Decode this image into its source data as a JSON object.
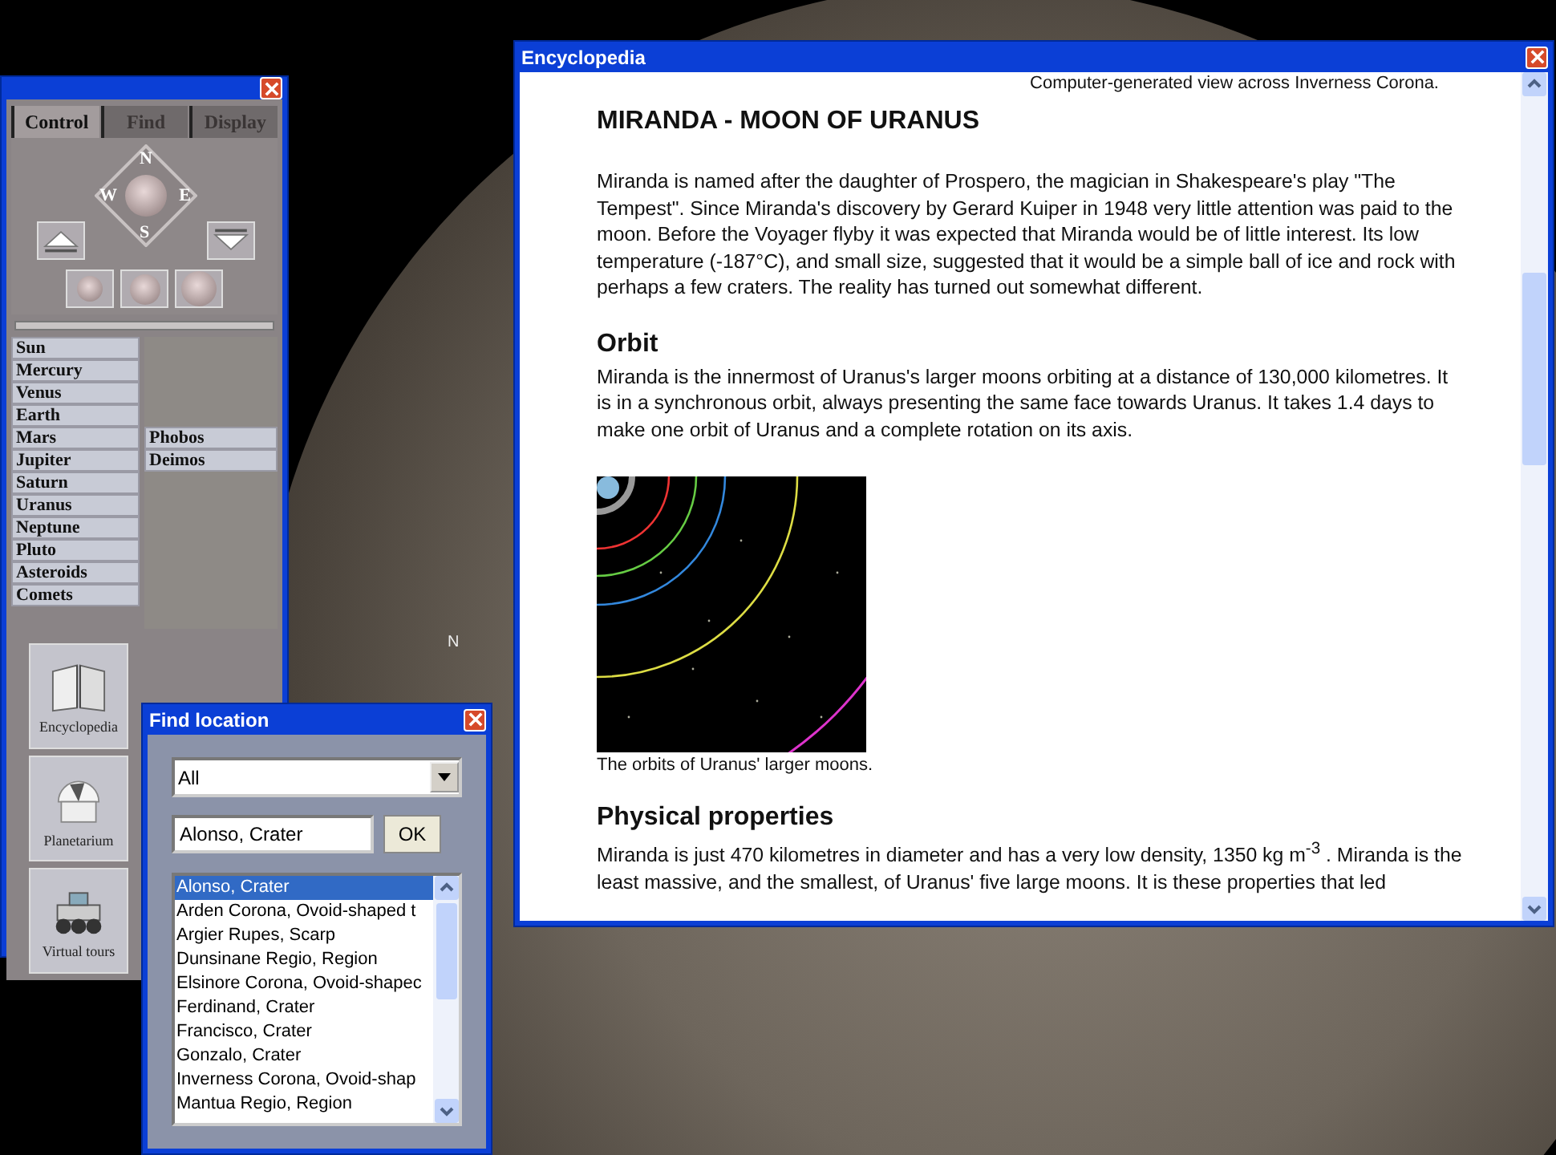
{
  "moon_marker": "N",
  "control_panel": {
    "tabs": [
      {
        "label": "Control",
        "selected": true
      },
      {
        "label": "Find",
        "selected": false
      },
      {
        "label": "Display",
        "selected": false
      }
    ],
    "compass": {
      "north": "N",
      "east": "E",
      "south": "S",
      "west": "W"
    },
    "planets": [
      {
        "label": "Sun"
      },
      {
        "label": "Mercury"
      },
      {
        "label": "Venus"
      },
      {
        "label": "Earth"
      },
      {
        "label": "Mars",
        "moons": [
          "Phobos",
          "Deimos"
        ]
      },
      {
        "label": "Jupiter"
      },
      {
        "label": "Saturn"
      },
      {
        "label": "Uranus"
      },
      {
        "label": "Neptune"
      },
      {
        "label": "Pluto"
      },
      {
        "label": "Asteroids"
      },
      {
        "label": "Comets"
      }
    ],
    "tools": [
      {
        "kind": "book",
        "label": "Encyclopedia"
      },
      {
        "kind": "dome",
        "label": "Planetarium"
      },
      {
        "kind": "rover",
        "label": "Virtual tours"
      }
    ]
  },
  "find_location": {
    "title": "Find location",
    "category": "All",
    "search_value": "Alonso, Crater",
    "ok_button": "OK",
    "results": [
      {
        "label": "Alonso, Crater",
        "selected": true
      },
      {
        "label": "Arden Corona, Ovoid-shaped t",
        "selected": false
      },
      {
        "label": "Argier Rupes, Scarp",
        "selected": false
      },
      {
        "label": "Dunsinane Regio, Region",
        "selected": false
      },
      {
        "label": "Elsinore Corona, Ovoid-shapec",
        "selected": false
      },
      {
        "label": "Ferdinand, Crater",
        "selected": false
      },
      {
        "label": "Francisco, Crater",
        "selected": false
      },
      {
        "label": "Gonzalo, Crater",
        "selected": false
      },
      {
        "label": "Inverness Corona, Ovoid-shap",
        "selected": false
      },
      {
        "label": "Mantua Regio, Region",
        "selected": false
      }
    ]
  },
  "encyclopedia": {
    "title": "Encyclopedia",
    "top_caption": "Computer-generated view across Inverness Corona.",
    "heading": "MIRANDA - MOON OF URANUS",
    "intro": "Miranda is named after the daughter of Prospero, the magician in Shakespeare's play \"The Tempest\". Since Miranda's discovery by Gerard Kuiper in 1948 very little attention was paid to the moon. Before the Voyager flyby it was expected that Miranda would be of little interest. Its low temperature (-187°C), and small size, suggested that it would be a simple ball of ice and rock with perhaps a few craters. The reality has turned out somewhat different.",
    "sections": [
      {
        "kind": "text",
        "heading": "Orbit",
        "text": "Miranda is the innermost of Uranus's larger moons orbiting at a distance of 130,000 kilometres. It is in a synchronous orbit, always presenting the same face towards Uranus. It takes 1.4 days to make one orbit of Uranus and a complete rotation on its axis."
      },
      {
        "kind": "figure",
        "caption": "The orbits of Uranus' larger moons."
      },
      {
        "kind": "text",
        "heading": "Physical properties",
        "text": "Miranda is just 470 kilometres in diameter and has a very low density, 1350 kg m$^{-3}$ . Miranda is the least massive, and the smallest, of Uranus' five large moons. It is these properties that led"
      }
    ]
  }
}
